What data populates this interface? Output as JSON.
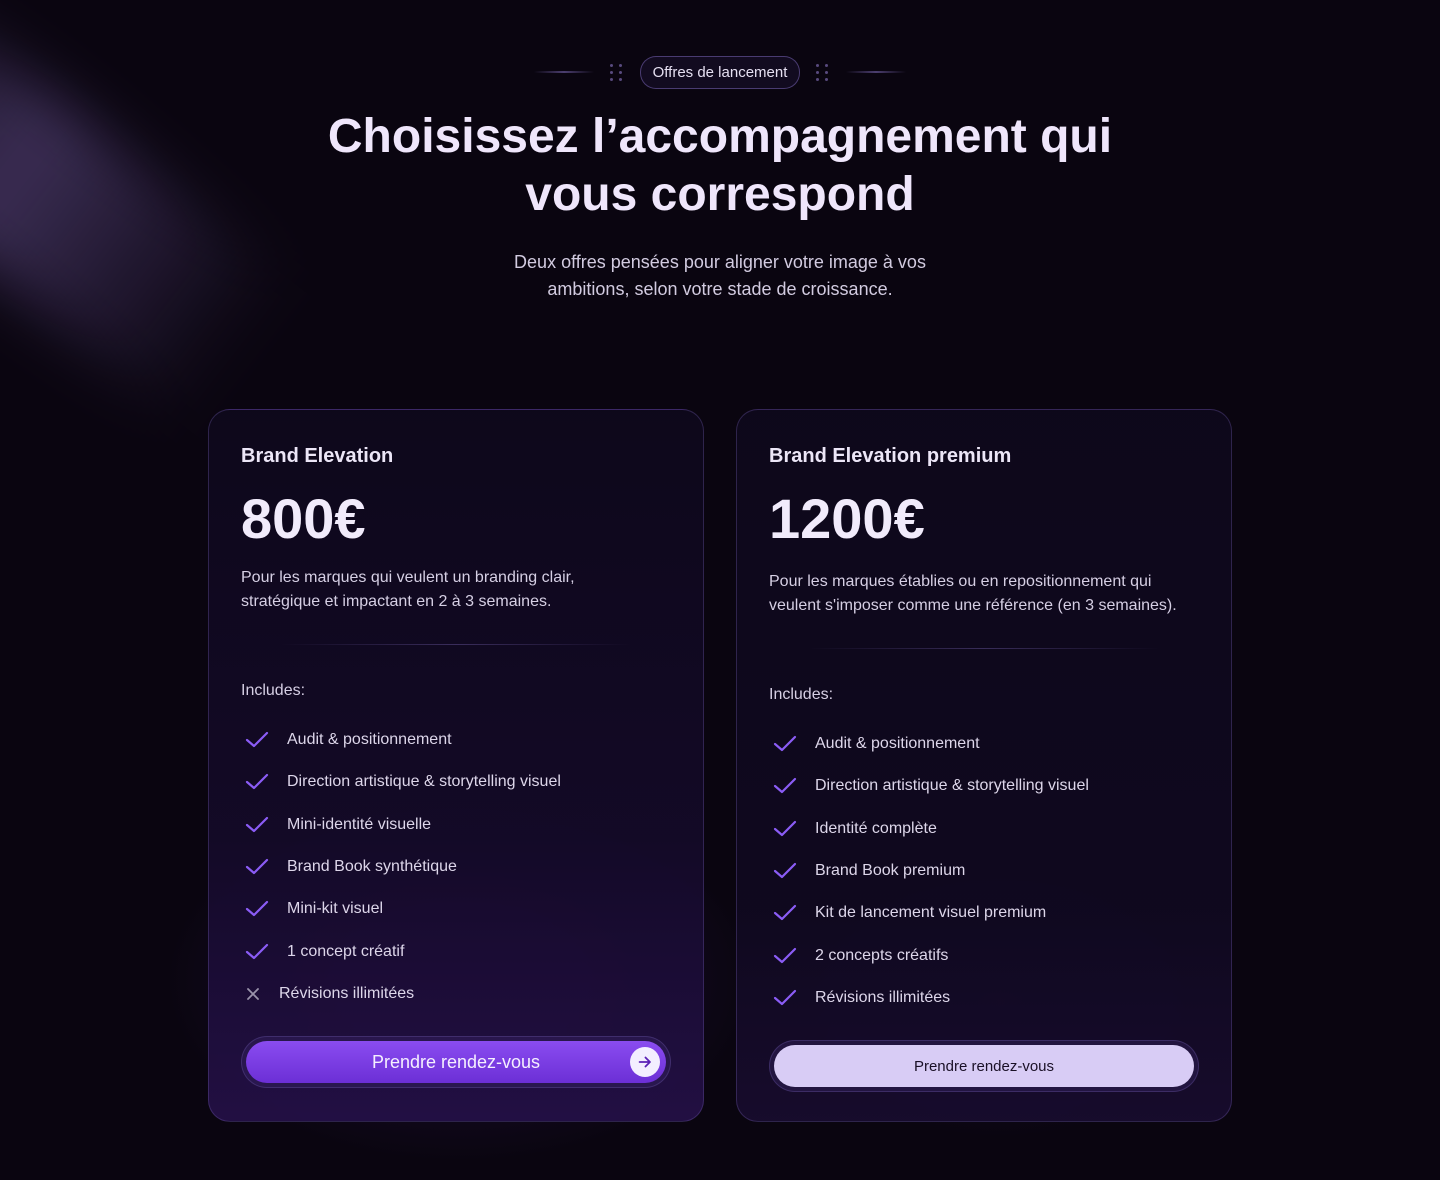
{
  "colors": {
    "background": "#0a0510",
    "accent": "#7a3ce6",
    "check": "#8b5cf6",
    "secondary_button": "#d8ccf5"
  },
  "header": {
    "badge": "Offres de lancement",
    "title_line1": "Choisissez l’accompagnement qui",
    "title_line2": "vous correspond",
    "subtitle_line1": "Deux offres pensées pour aligner votre image à vos",
    "subtitle_line2": "ambitions, selon votre stade de croissance."
  },
  "plans": [
    {
      "name": "Brand Elevation",
      "price": "800€",
      "desc_line1": "Pour les marques qui veulent un branding clair,",
      "desc_line2": "stratégique et impactant en 2 à 3 semaines.",
      "includes_label": "Includes:",
      "features": [
        {
          "label": "Audit & positionnement",
          "icon": "check-icon"
        },
        {
          "label": "Direction artistique & storytelling visuel",
          "icon": "check-icon"
        },
        {
          "label": "Mini-identité visuelle",
          "icon": "check-icon"
        },
        {
          "label": "Brand Book synthétique",
          "icon": "check-icon"
        },
        {
          "label": "Mini-kit visuel",
          "icon": "check-icon"
        },
        {
          "label": "1 concept créatif",
          "icon": "check-icon"
        },
        {
          "label": "Révisions illimitées",
          "icon": "x-icon"
        }
      ],
      "cta": "Prendre rendez-vous",
      "cta_icon": "arrow-right-icon"
    },
    {
      "name": "Brand Elevation premium",
      "price": "1200€",
      "desc_line1": "Pour les marques établies ou en repositionnement qui",
      "desc_line2": "veulent s'imposer comme une référence (en 3 semaines).",
      "includes_label": "Includes:",
      "features": [
        {
          "label": "Audit & positionnement",
          "icon": "check-icon"
        },
        {
          "label": "Direction artistique & storytelling visuel",
          "icon": "check-icon"
        },
        {
          "label": "Identité complète",
          "icon": "check-icon"
        },
        {
          "label": "Brand Book premium",
          "icon": "check-icon"
        },
        {
          "label": "Kit de lancement visuel premium",
          "icon": "check-icon"
        },
        {
          "label": "2 concepts créatifs",
          "icon": "check-icon"
        },
        {
          "label": "Révisions illimitées",
          "icon": "check-icon"
        }
      ],
      "cta": "Prendre rendez-vous"
    }
  ]
}
